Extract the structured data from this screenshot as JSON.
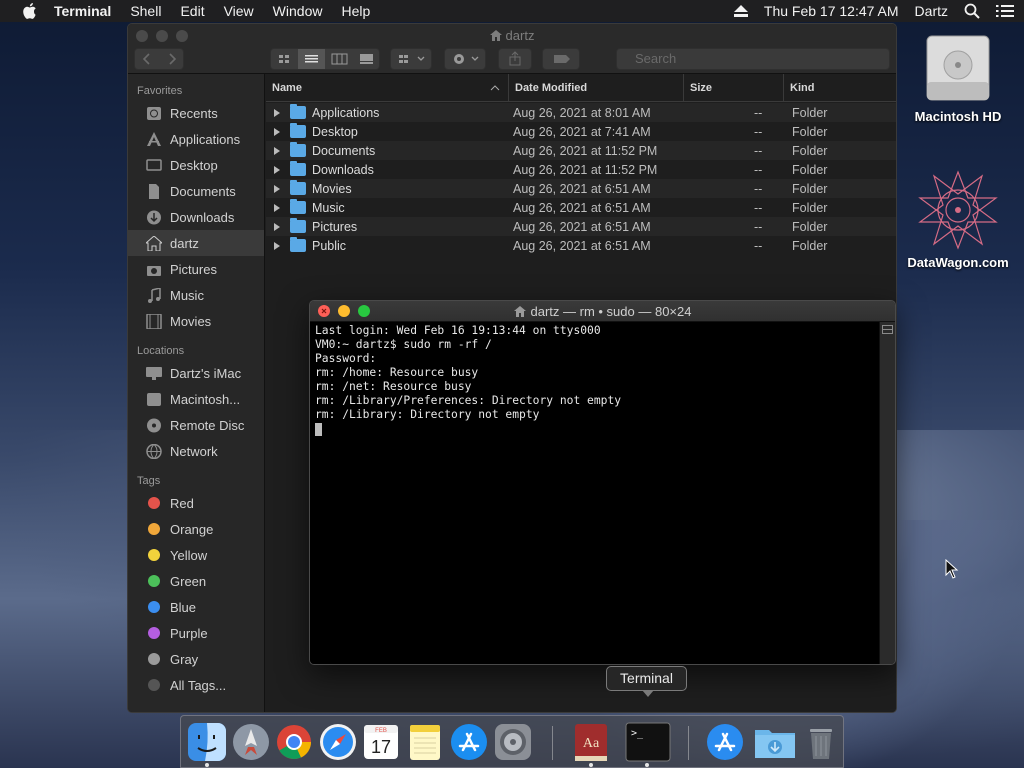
{
  "menubar": {
    "app": "Terminal",
    "items": [
      "Shell",
      "Edit",
      "View",
      "Window",
      "Help"
    ],
    "clock": "Thu Feb 17  12:47 AM",
    "user": "Dartz"
  },
  "finder": {
    "title": "dartz",
    "search_placeholder": "Search",
    "sidebar": {
      "favorites_label": "Favorites",
      "favorites": [
        "Recents",
        "Applications",
        "Desktop",
        "Documents",
        "Downloads",
        "dartz",
        "Pictures",
        "Music",
        "Movies"
      ],
      "locations_label": "Locations",
      "locations": [
        "Dartz's iMac",
        "Macintosh...",
        "Remote Disc",
        "Network"
      ],
      "tags_label": "Tags",
      "tags": [
        {
          "label": "Red",
          "color": "#e5534b"
        },
        {
          "label": "Orange",
          "color": "#f0a73a"
        },
        {
          "label": "Yellow",
          "color": "#f2d33c"
        },
        {
          "label": "Green",
          "color": "#4cc05a"
        },
        {
          "label": "Blue",
          "color": "#3b8ef0"
        },
        {
          "label": "Purple",
          "color": "#b45ee0"
        },
        {
          "label": "Gray",
          "color": "#9a9a9a"
        },
        {
          "label": "All Tags...",
          "color": "#555555"
        }
      ]
    },
    "columns": {
      "name": "Name",
      "date": "Date Modified",
      "size": "Size",
      "kind": "Kind"
    },
    "rows": [
      {
        "name": "Applications",
        "date": "Aug 26, 2021 at 8:01 AM",
        "size": "--",
        "kind": "Folder"
      },
      {
        "name": "Desktop",
        "date": "Aug 26, 2021 at 7:41 AM",
        "size": "--",
        "kind": "Folder"
      },
      {
        "name": "Documents",
        "date": "Aug 26, 2021 at 11:52 PM",
        "size": "--",
        "kind": "Folder"
      },
      {
        "name": "Downloads",
        "date": "Aug 26, 2021 at 11:52 PM",
        "size": "--",
        "kind": "Folder"
      },
      {
        "name": "Movies",
        "date": "Aug 26, 2021 at 6:51 AM",
        "size": "--",
        "kind": "Folder"
      },
      {
        "name": "Music",
        "date": "Aug 26, 2021 at 6:51 AM",
        "size": "--",
        "kind": "Folder"
      },
      {
        "name": "Pictures",
        "date": "Aug 26, 2021 at 6:51 AM",
        "size": "--",
        "kind": "Folder"
      },
      {
        "name": "Public",
        "date": "Aug 26, 2021 at 6:51 AM",
        "size": "--",
        "kind": "Folder"
      }
    ]
  },
  "terminal": {
    "title": "dartz — rm • sudo — 80×24",
    "lines": [
      "Last login: Wed Feb 16 19:13:44 on ttys000",
      "VM0:~ dartz$ sudo rm -rf /",
      "Password:",
      "rm: /home: Resource busy",
      "rm: /net: Resource busy",
      "rm: /Library/Preferences: Directory not empty",
      "rm: /Library: Directory not empty"
    ]
  },
  "desktop": {
    "hd_label": "Macintosh HD",
    "dw_label": "DataWagon.com"
  },
  "tooltip": "Terminal",
  "dock": {
    "items": [
      "finder-icon",
      "launchpad-icon",
      "chrome-icon",
      "safari-icon",
      "calendar-icon",
      "notes-icon",
      "app-store-icon",
      "system-preferences-icon",
      "dictionary-icon",
      "terminal-icon",
      "app-store-folder-icon",
      "downloads-folder-icon",
      "trash-icon"
    ],
    "calendar_month": "FEB",
    "calendar_day": "17",
    "dictionary_glyph": "Aa",
    "terminal_glyph": ">_"
  }
}
